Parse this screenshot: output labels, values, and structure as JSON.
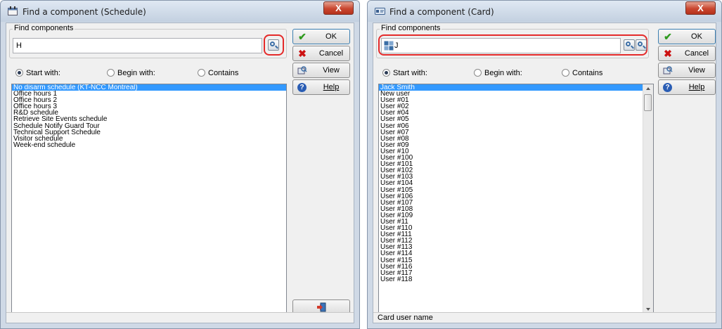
{
  "windows": [
    {
      "title": "Find a component (Schedule)",
      "close_label": "X",
      "group_label": "Find components",
      "search_value": "H",
      "radios": [
        {
          "label": "Start with:",
          "checked": true
        },
        {
          "label": "Begin with:",
          "checked": false
        },
        {
          "label": "Contains",
          "checked": false
        }
      ],
      "buttons": {
        "ok": "OK",
        "cancel": "Cancel",
        "view": "View",
        "help": "Help"
      },
      "items": [
        "No disarm schedule (KT-NCC Montreal)",
        "Office hours 1",
        "Office hours 2",
        "Office hours 3",
        "R&D schedule",
        "Retrieve Site Events schedule",
        "Schedule Notify Guard Tour",
        "Technical Support Schedule",
        "Visitor schedule",
        "Week-end schedule"
      ],
      "selected_index": 0,
      "status": ""
    },
    {
      "title": "Find a component (Card)",
      "close_label": "X",
      "group_label": "Find components",
      "search_value": "J",
      "radios": [
        {
          "label": "Start with:",
          "checked": true
        },
        {
          "label": "Begin with:",
          "checked": false
        },
        {
          "label": "Contains",
          "checked": false
        }
      ],
      "buttons": {
        "ok": "OK",
        "cancel": "Cancel",
        "view": "View",
        "help": "Help"
      },
      "items": [
        "Jack Smith",
        "New user",
        "User #01",
        "User #02",
        "User #04",
        "User #05",
        "User #06",
        "User #07",
        "User #08",
        "User #09",
        "User #10",
        "User #100",
        "User #101",
        "User #102",
        "User #103",
        "User #104",
        "User #105",
        "User #106",
        "User #107",
        "User #108",
        "User #109",
        "User #11",
        "User #110",
        "User #111",
        "User #112",
        "User #113",
        "User #114",
        "User #115",
        "User #116",
        "User #117",
        "User #118"
      ],
      "selected_index": 0,
      "status": "Card user name"
    }
  ],
  "colors": {
    "selection": "#3399ff",
    "red_ring": "#e42a2a",
    "ok_green": "#2f9a1e",
    "cancel_red": "#cc1111"
  },
  "icons": {
    "search": "magnifier-icon",
    "ok": "checkmark-icon",
    "cancel": "x-icon",
    "view": "view-icon",
    "help": "help-icon",
    "exit": "exit-door-icon"
  }
}
